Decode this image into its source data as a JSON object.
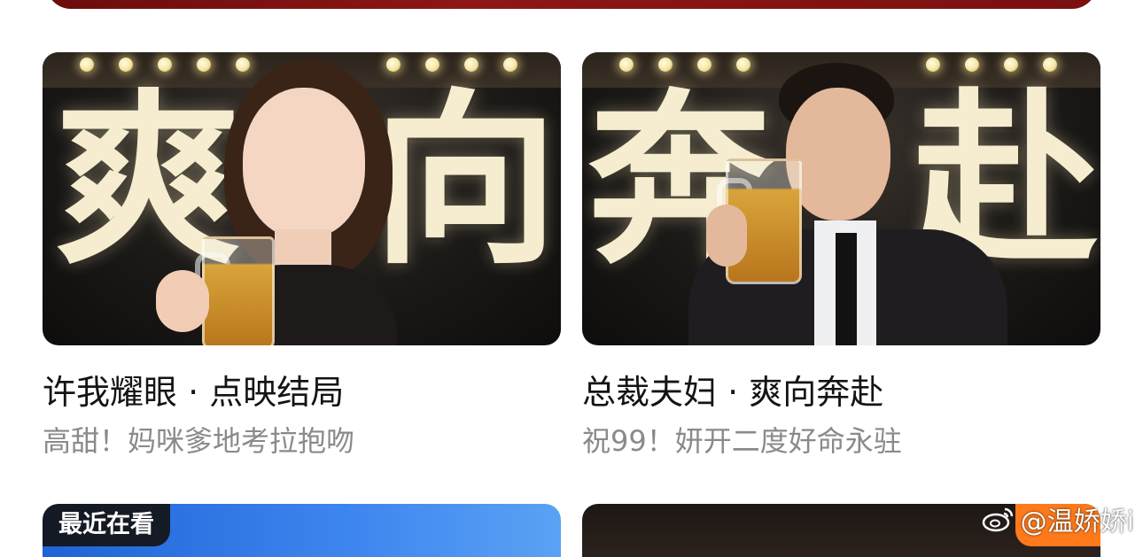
{
  "cards": [
    {
      "title": "许我耀眼 · 点映结局",
      "subtitle": "高甜！妈咪爹地考拉抱吻",
      "poster_chars": [
        "爽",
        "向"
      ]
    },
    {
      "title": "总裁夫妇 · 爽向奔赴",
      "subtitle": "祝99！妍开二度好命永驻",
      "poster_chars": [
        "奔",
        "赴"
      ]
    }
  ],
  "next_row": {
    "left_tag": "最近在看"
  },
  "watermark": {
    "text": "@温娇娇i"
  }
}
